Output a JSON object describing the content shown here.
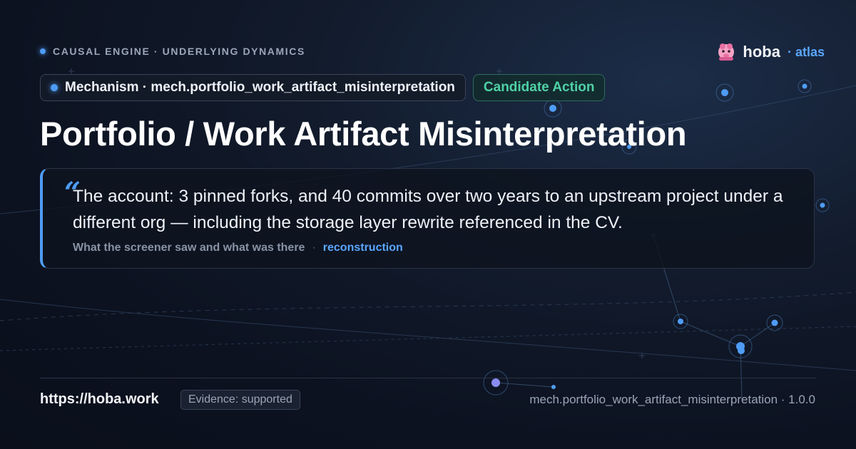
{
  "header": {
    "eyebrow": "CAUSAL ENGINE · UNDERLYING DYNAMICS",
    "brand_name": "hoba",
    "brand_sub": "· atlas"
  },
  "chips": {
    "mechanism": "Mechanism · mech.portfolio_work_artifact_misinterpretation",
    "action": "Candidate Action"
  },
  "title": "Portfolio / Work Artifact Misinterpretation",
  "quote": {
    "mark": "“",
    "text": "The account: 3 pinned forks, and 40 commits over two years to an upstream project under a different org — including the storage layer rewrite referenced in the CV.",
    "source": "What the screener saw and what was there",
    "separator": "·",
    "tag": "reconstruction"
  },
  "footer": {
    "url": "https://hoba.work",
    "evidence": "Evidence: supported",
    "id_version": "mech.portfolio_work_artifact_misinterpretation · 1.0.0"
  },
  "colors": {
    "accent": "#4e9cf5",
    "action": "#4fd1a6",
    "brand_sub": "#5aa6ff"
  },
  "icons": {
    "brand": "hoba-mascot-icon",
    "status": "status-dot-icon"
  }
}
